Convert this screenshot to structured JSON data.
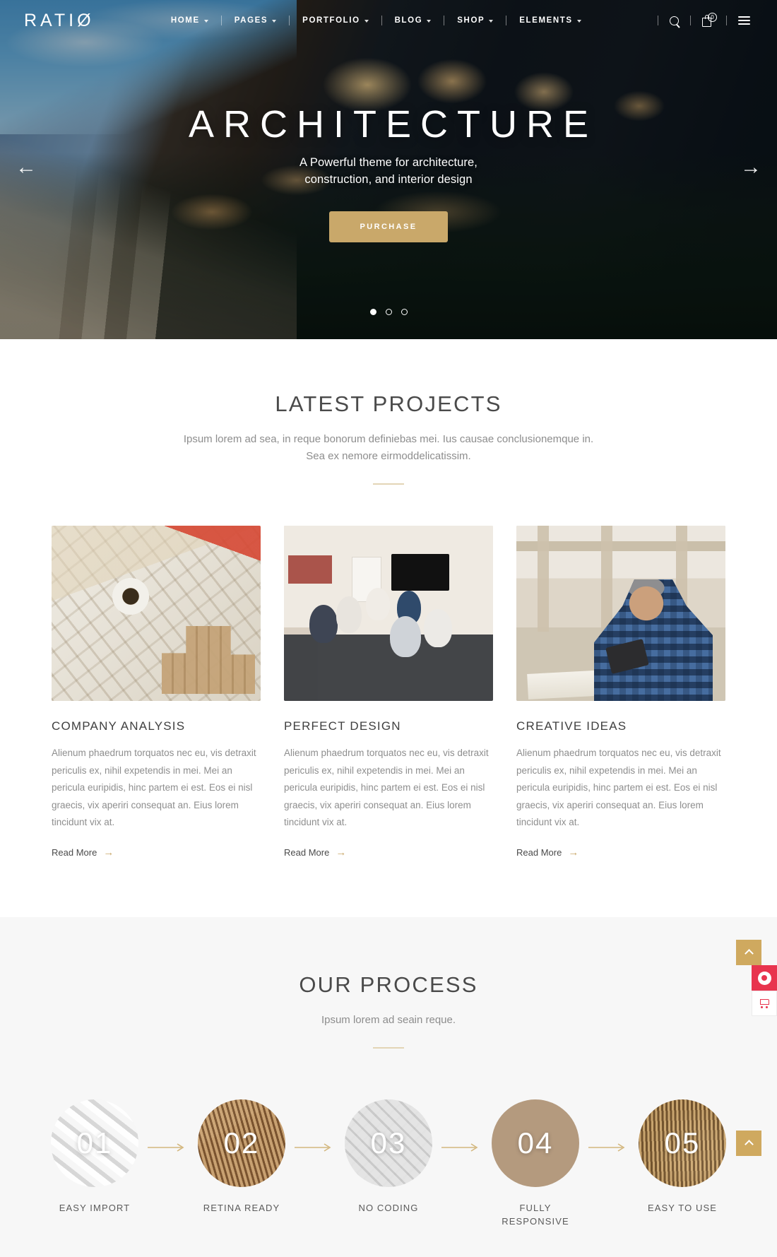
{
  "header": {
    "logo": "RATIØ",
    "nav": [
      {
        "label": "HOME",
        "has_dropdown": true
      },
      {
        "label": "PAGES",
        "has_dropdown": true
      },
      {
        "label": "PORTFOLIO",
        "has_dropdown": true
      },
      {
        "label": "BLOG",
        "has_dropdown": true
      },
      {
        "label": "SHOP",
        "has_dropdown": true
      },
      {
        "label": "ELEMENTS",
        "has_dropdown": true
      }
    ],
    "search_icon": "search-icon",
    "cart_icon": "cart-icon",
    "cart_count": "0",
    "menu_icon": "hamburger-icon"
  },
  "hero": {
    "title": "ARCHITECTURE",
    "subtitle_line1": "A Powerful theme for architecture,",
    "subtitle_line2": "construction, and interior design",
    "cta_label": "PURCHASE",
    "prev_arrow": "←",
    "next_arrow": "→",
    "slides": 3,
    "active_slide": 1
  },
  "projects": {
    "title": "LATEST PROJECTS",
    "subtitle_line1": "Ipsum lorem ad sea, in reque bonorum definiebas mei. Ius causae conclusionemque",
    "subtitle_line2": "in. Sea ex nemore eirmoddelicatissim.",
    "body_text": "Alienum phaedrum torquatos nec eu, vis detraxit periculis ex, nihil expetendis in mei. Mei an pericula euripidis, hinc partem ei est. Eos ei nisl graecis, vix aperiri consequat an. Eius lorem tincidunt vix at.",
    "read_more_label": "Read More",
    "read_more_arrow": "→",
    "cards": [
      {
        "title": "COMPANY ANALYSIS",
        "image": "blueprint-desk-flatlay"
      },
      {
        "title": "PERFECT DESIGN",
        "image": "team-meeting-room"
      },
      {
        "title": "CREATIVE IDEAS",
        "image": "man-with-tablet-jobsite"
      }
    ]
  },
  "process": {
    "title": "OUR PROCESS",
    "subtitle": "Ipsum lorem ad seain reque.",
    "steps": [
      {
        "number": "01",
        "label": "EASY IMPORT"
      },
      {
        "number": "02",
        "label": "RETINA READY"
      },
      {
        "number": "03",
        "label": "NO CODING"
      },
      {
        "number": "04",
        "label": "FULLY RESPONSIVE"
      },
      {
        "number": "05",
        "label": "EASY TO USE"
      }
    ]
  },
  "floating": {
    "scroll_top_icon": "chevron-up-icon",
    "purchase_icon": "purchase-badge-icon",
    "cart_icon": "cart-icon"
  },
  "colors": {
    "accent_gold": "#c9a86a",
    "accent_red": "#e8344e",
    "text_dark": "#4a4a4a",
    "text_muted": "#8e8e8e",
    "section_grey": "#f7f7f7"
  }
}
